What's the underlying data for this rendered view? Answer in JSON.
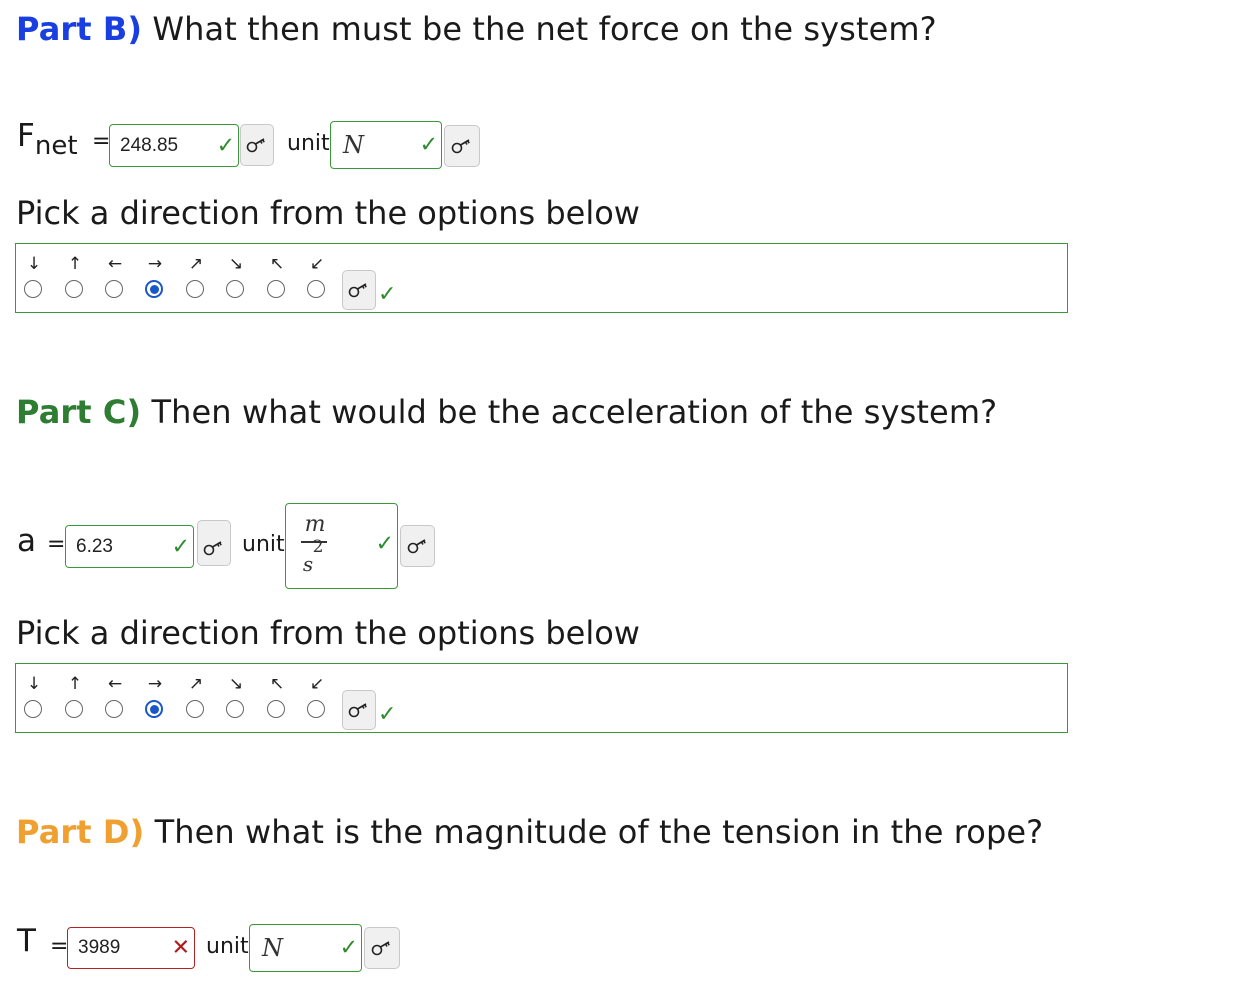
{
  "part_b": {
    "label": "Part B)",
    "question": " What then must be the net force on the system?",
    "var_main": "F",
    "var_sub": "net",
    "equals": "=",
    "value": "248.85",
    "value_status": "correct",
    "unit_label": "unit",
    "unit_value": "N",
    "unit_status": "correct",
    "direction_prompt": "Pick a direction from the options below",
    "direction_options": [
      "↓",
      "↑",
      "←",
      "→",
      "↗",
      "↘",
      "↖",
      "↙"
    ],
    "direction_selected": "→",
    "direction_status": "correct"
  },
  "part_c": {
    "label": "Part C)",
    "question": " Then what would be the acceleration of the system?",
    "var_main": "a",
    "equals": "=",
    "value": "6.23",
    "value_status": "correct",
    "unit_label": "unit",
    "unit_numerator": "m",
    "unit_denominator": "s",
    "unit_exponent": "2",
    "unit_status": "correct",
    "direction_prompt": "Pick a direction from the options below",
    "direction_options": [
      "↓",
      "↑",
      "←",
      "→",
      "↗",
      "↘",
      "↖",
      "↙"
    ],
    "direction_selected": "→",
    "direction_status": "correct"
  },
  "part_d": {
    "label": "Part D)",
    "question": " Then what is the magnitude of the tension in the rope?",
    "var_main": "T",
    "equals": "=",
    "value": "3989",
    "value_status": "incorrect",
    "unit_label": "unit",
    "unit_value": "N",
    "unit_status": "correct"
  },
  "marks": {
    "correct": "✓",
    "incorrect": "✕"
  },
  "colors": {
    "part_b": "#1a3fe0",
    "part_c": "#2e7d32",
    "part_d": "#f0a030",
    "correct": "#2e8b2e",
    "incorrect": "#b01a1a",
    "selected_radio": "#1a56c8"
  },
  "icons": {
    "key_button": "key-icon"
  }
}
